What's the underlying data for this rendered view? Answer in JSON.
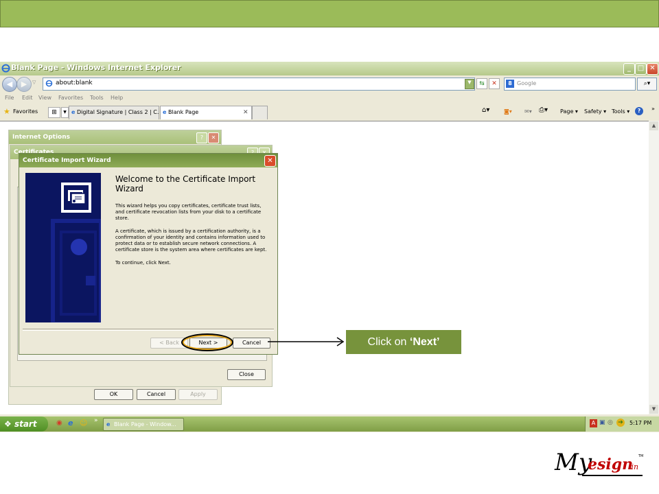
{
  "colors": {
    "slide_accent": "#9bbb59",
    "callout_bg": "#77933c",
    "xp_title_green": "#8eab57",
    "close_red": "#d94d2b",
    "logo_red": "#c00000"
  },
  "browser": {
    "title": "Blank Page - Windows Internet Explorer",
    "address": "about:blank",
    "search_placeholder": "Google",
    "menu": [
      "File",
      "Edit",
      "View",
      "Favorites",
      "Tools",
      "Help"
    ],
    "favorites_label": "Favorites",
    "tabs": [
      {
        "label": "Digital Signature | Class 2 | C..."
      },
      {
        "label": "Blank Page"
      }
    ],
    "commands": {
      "page": "Page ▾",
      "safety": "Safety ▾",
      "tools": "Tools ▾"
    }
  },
  "internet_options": {
    "title": "Internet Options",
    "buttons": {
      "ok": "OK",
      "cancel": "Cancel",
      "apply": "Apply"
    }
  },
  "certificates": {
    "title": "Certificates",
    "close_label": "Close"
  },
  "wizard": {
    "title": "Certificate Import Wizard",
    "heading": "Welcome to the Certificate Import Wizard",
    "paragraphs": [
      "This wizard helps you copy certificates, certificate trust lists, and certificate revocation lists from your disk to a certificate store.",
      "A certificate, which is issued by a certification authority, is a confirmation of your identity and contains information used to protect data or to establish secure network connections. A certificate store is the system area where certificates are kept.",
      "To continue, click Next."
    ],
    "buttons": {
      "back": "< Back",
      "next": "Next >",
      "cancel": "Cancel"
    }
  },
  "callout": {
    "prefix": "Click on ",
    "highlight": "‘Next’"
  },
  "taskbar": {
    "start": "start",
    "task_item": "Blank Page - Window...",
    "clock": "5:17 PM"
  },
  "logo": {
    "text_black": "My",
    "text_red": "esign",
    "suffix": ".in",
    "tm": "TM"
  }
}
